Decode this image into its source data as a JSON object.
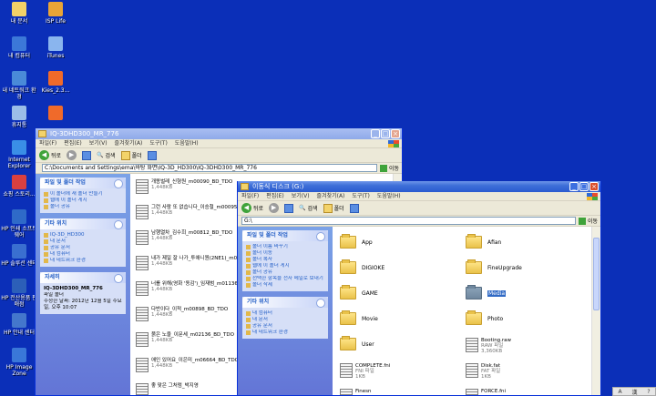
{
  "desktop_icons": [
    {
      "label": "내 문서",
      "color": "#f2d168",
      "col": 0,
      "row": 0
    },
    {
      "label": "ISP Life",
      "color": "#e8a437",
      "col": 1,
      "row": 0
    },
    {
      "label": "내 컴퓨터",
      "color": "#3c78d8",
      "col": 0,
      "row": 1
    },
    {
      "label": "iTunes",
      "color": "#8ab5ee",
      "col": 1,
      "row": 1
    },
    {
      "label": "내 네트워크 환경",
      "color": "#4a8ad8",
      "col": 0,
      "row": 2
    },
    {
      "label": "Kies_2.3...",
      "color": "#f06a2a",
      "col": 1,
      "row": 2
    },
    {
      "label": "휴지통",
      "color": "#9bbde8",
      "col": 0,
      "row": 3
    },
    {
      "label": "",
      "color": "#f06a2a",
      "col": 1,
      "row": 3
    },
    {
      "label": "Internet Explorer",
      "color": "#3a8ee6",
      "col": 0,
      "row": 4
    },
    {
      "label": "쇼핑 스토리...",
      "color": "#d94040",
      "col": 0,
      "row": 5
    },
    {
      "label": "HP 인쇄 소프트웨어",
      "color": "#2f6ac8",
      "col": 0,
      "row": 6
    },
    {
      "label": "HP 솔루션 센터",
      "color": "#3a6fd0",
      "col": 0,
      "row": 7
    },
    {
      "label": "HP 전산용품 판매점",
      "color": "#2c5fb8",
      "col": 0,
      "row": 8
    },
    {
      "label": "HP 안내 센터",
      "color": "#4477cc",
      "col": 0,
      "row": 9
    },
    {
      "label": "HP Image Zone",
      "color": "#3a77d8",
      "col": 0,
      "row": 10
    }
  ],
  "win1": {
    "title": "IQ-3DHD300_MR_776",
    "menu": [
      "파일(F)",
      "편집(E)",
      "보기(V)",
      "즐겨찾기(A)",
      "도구(T)",
      "도움말(H)"
    ],
    "back": "뒤로",
    "search": "검색",
    "folders": "폴더",
    "address": "C:\\Documents and Settings\\ema\\바탕 화면\\IQ-3D_HD300\\IQ-3DHD300_MR_776",
    "go": "이동",
    "tasks": {
      "title": "파일 및 폴더 작업",
      "items": [
        "이 폴더에 새 폴더 만들기",
        "웹에 이 폴더 게시",
        "폴더 공유"
      ]
    },
    "places": {
      "title": "기타 위치",
      "items": [
        "IQ-3D_HD300",
        "내 문서",
        "공유 문서",
        "내 컴퓨터",
        "내 네트워크 환경"
      ]
    },
    "details": {
      "title": "자세히",
      "lines": [
        "IQ-3DHD300_MR_776",
        "파일 폴더",
        "수정한 날짜: 2012년 12월 5일 수요일, 오후 10:07"
      ]
    },
    "files": [
      {
        "name": "개똥벌레_신형원_m00090_BD_TDO",
        "size": "1,448KB"
      },
      {
        "name": "그런 사람 또 없습니다_이승철_m00095_BD_TDO",
        "size": "1,448KB"
      },
      {
        "name": "남행열차_김수희_m00812_BD_TDO",
        "size": "1,448KB"
      },
      {
        "name": "내가 제일 잘 나가_투애니원(2NE1)_m01396_BD_TDO",
        "size": "1,448KB"
      },
      {
        "name": "너를 위해(영화 '동감')_임재범_m01136_BD_TDO",
        "size": "1,448KB"
      },
      {
        "name": "다반이다_이적_m00898_BD_TDO",
        "size": "1,448KB"
      },
      {
        "name": "붉은 노을_이문세_m02136_BD_TDO",
        "size": "1,448KB"
      },
      {
        "name": "애인 있어요_이은미_m06664_BD_TDO",
        "size": "1,448KB"
      },
      {
        "name": "좋 맞은 그처럼_박지영",
        "size": ""
      }
    ]
  },
  "win2": {
    "title": "이동식 디스크 (G:)",
    "menu": [
      "파일(F)",
      "편집(E)",
      "보기(V)",
      "즐겨찾기(A)",
      "도구(T)",
      "도움말(H)"
    ],
    "back": "뒤로",
    "search": "검색",
    "folders": "폴더",
    "address": "G:\\",
    "go": "이동",
    "tasks": {
      "title": "파일 및 폴더 작업",
      "items": [
        "폴더 이름 바꾸기",
        "폴더 이동",
        "폴더 복사",
        "웹에 이 폴더 게시",
        "폴더 공유",
        "선택한 항목을 전자 메일로 보내기",
        "폴더 삭제"
      ]
    },
    "places": {
      "title": "기타 위치",
      "items": [
        "내 컴퓨터",
        "내 문서",
        "공유 문서",
        "내 네트워크 환경"
      ]
    },
    "folders_list": [
      {
        "name": "App",
        "col": 0,
        "row": 0
      },
      {
        "name": "Afian",
        "col": 1,
        "row": 0
      },
      {
        "name": "DIGIOKE",
        "col": 0,
        "row": 1
      },
      {
        "name": "FineUpgrade",
        "col": 1,
        "row": 1
      },
      {
        "name": "GAME",
        "col": 0,
        "row": 2
      },
      {
        "name": "Media",
        "col": 1,
        "row": 2,
        "selected": true
      },
      {
        "name": "Movie",
        "col": 0,
        "row": 3
      },
      {
        "name": "Photo",
        "col": 1,
        "row": 3
      },
      {
        "name": "User",
        "col": 0,
        "row": 4
      }
    ],
    "files_list": [
      {
        "name": "Booting.raw",
        "type": "RAW 파일",
        "size": "3,360KB",
        "col": 1,
        "row": 4
      },
      {
        "name": "COMPLETE.fni",
        "type": "FNI 파일",
        "size": "1KB",
        "col": 0,
        "row": 5
      },
      {
        "name": "Disk.fat",
        "type": "FAT 파일",
        "size": "1KB",
        "col": 1,
        "row": 5
      },
      {
        "name": "Finesn",
        "type": "",
        "size": "",
        "col": 0,
        "row": 6
      },
      {
        "name": "FORCE.fni",
        "type": "",
        "size": "",
        "col": 1,
        "row": 6
      }
    ]
  },
  "tray": {
    "a": "A",
    "b": "漢",
    "c": "?"
  }
}
